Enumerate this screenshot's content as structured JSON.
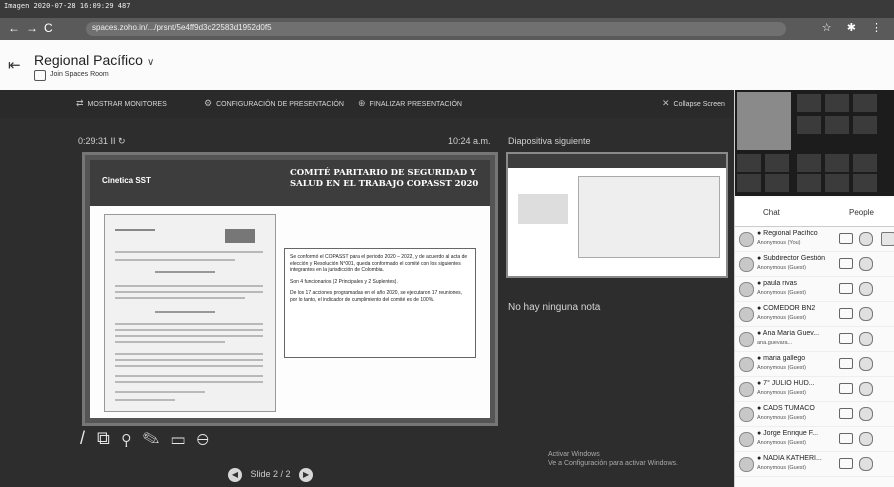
{
  "screen": {
    "caption": "Imagen 2020-07-28 16:09:29 487"
  },
  "browser": {
    "url": "spaces.zoho.in/.../prsnt/5e4ff9d3c22583d1952d0f5",
    "nav": [
      "←",
      "→",
      "C"
    ],
    "right_icons": "☆ ✱ ⋮"
  },
  "header": {
    "title": "Regional Pacífico",
    "title_chevron": "∨",
    "subtitle": "Join Spaces Room",
    "exit_icon": "⇤"
  },
  "toolbar": {
    "items": [
      {
        "icon": "⇄",
        "label": "MOSTRAR MONITORES"
      },
      {
        "icon": "⚙",
        "label": "CONFIGURACIÓN DE PRESENTACIÓN"
      },
      {
        "icon": "⊕",
        "label": "FINALIZAR PRESENTACIÓN"
      }
    ],
    "collapse": "Collapse Screen",
    "collapse_icon": "✕"
  },
  "presenter": {
    "slide_counter": "0:29:31  II  ↻",
    "timer": "10:24 a.m.",
    "next_label": "Diapositiva siguiente",
    "notes": "No hay ninguna nota",
    "nav_text": "Slide 2 / 2",
    "tools": [
      "/",
      "⧉",
      "⚲",
      "✎",
      "▭",
      "⊖"
    ]
  },
  "slide": {
    "logo": "Cinetica SST",
    "title": "COMITÉ PARITARIO DE SEGURIDAD Y SALUD EN EL TRABAJO COPASST 2020",
    "paragraphs": [
      "Se conformó el COPASST para el periodo 2020 – 2022, y de acuerdo al acta de elección y Resolución N°001, queda conformado el comité con los siguientes integrantes en la jurisdicción de Colombia.",
      "Son 4 funcionarios (2 Principales y 2 Suplentes).",
      "De los 17 acciones programadas en el año 2020, se ejecutaron 17 reuniones, por lo tanto, el indicador de cumplimiento del comité es de 100%."
    ]
  },
  "watermark": [
    "Activar Windows",
    "Ve a Configuración para activar Windows."
  ],
  "sidepanel": {
    "tab_chat": "Chat",
    "tab_people": "People",
    "participants": [
      {
        "name": "● Regional Pacífico",
        "sub": "Anonymous (You)"
      },
      {
        "name": "● Subdirector Gestión",
        "sub": "Anonymous (Guest)"
      },
      {
        "name": "● paula rivas",
        "sub": "Anonymous (Guest)"
      },
      {
        "name": "● COMEDOR BN2",
        "sub": "Anonymous (Guest)"
      },
      {
        "name": "● Ana María Guev...",
        "sub": "ana.guevara..."
      },
      {
        "name": "● maria gallego",
        "sub": "Anonymous (Guest)"
      },
      {
        "name": "● 7° JULIO HUD...",
        "sub": "Anonymous (Guest)"
      },
      {
        "name": "● CADS TUMACO",
        "sub": "Anonymous (Guest)"
      },
      {
        "name": "● Jorge Enrique F...",
        "sub": "Anonymous (Guest)"
      },
      {
        "name": "● NADIA KATHERI...",
        "sub": "Anonymous (Guest)"
      }
    ]
  }
}
